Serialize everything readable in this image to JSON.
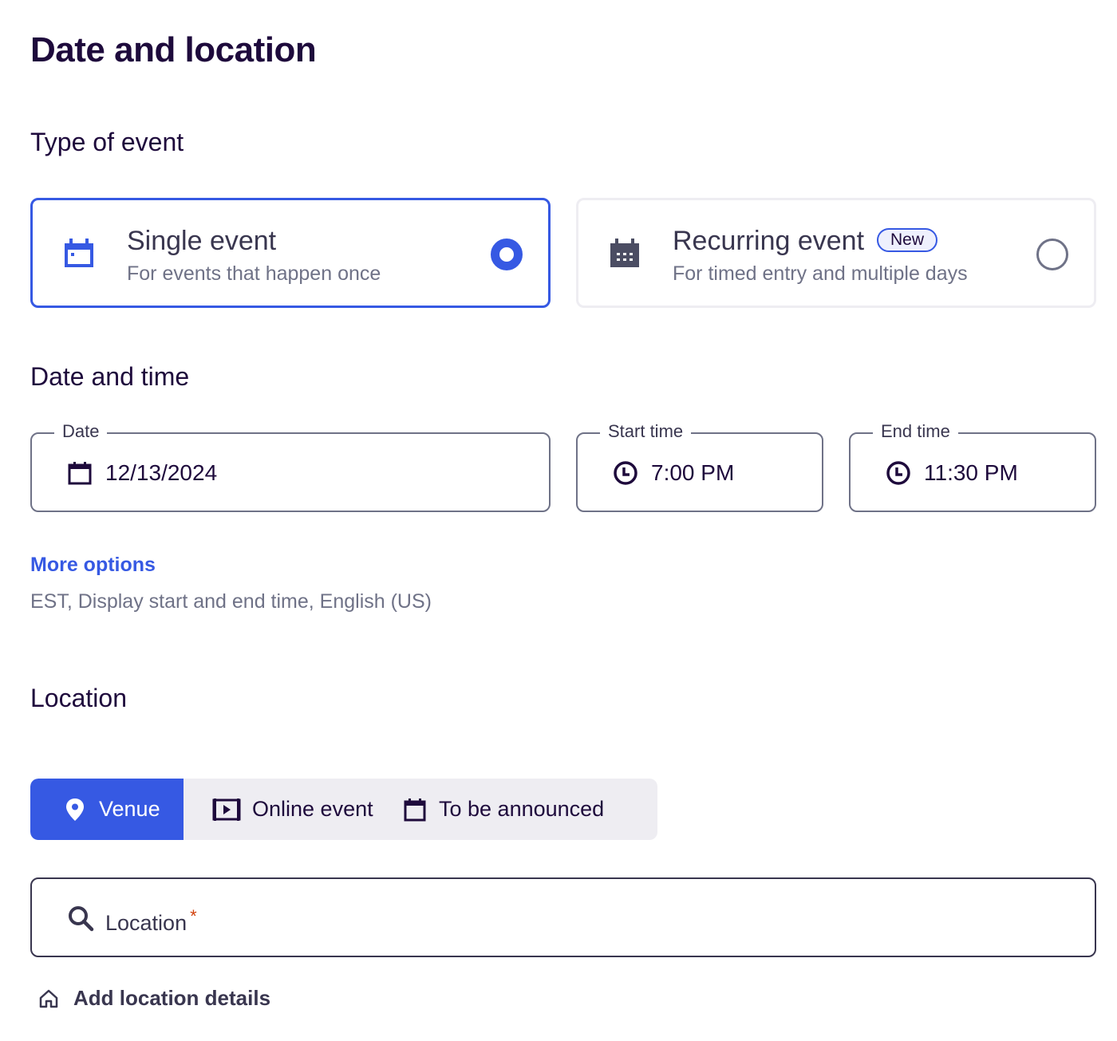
{
  "page": {
    "title": "Date and location"
  },
  "type_of_event": {
    "heading": "Type of event",
    "options": [
      {
        "title": "Single event",
        "subtitle": "For events that happen once",
        "selected": true,
        "icon": "calendar-icon"
      },
      {
        "title": "Recurring event",
        "badge": "New",
        "subtitle": "For timed entry and multiple days",
        "selected": false,
        "icon": "calendar-grid-icon"
      }
    ]
  },
  "date_and_time": {
    "heading": "Date and time",
    "date": {
      "label": "Date",
      "value": "12/13/2024",
      "icon": "calendar-icon"
    },
    "start_time": {
      "label": "Start time",
      "value": "7:00 PM",
      "icon": "clock-icon"
    },
    "end_time": {
      "label": "End time",
      "value": "11:30 PM",
      "icon": "clock-icon"
    },
    "more_options": {
      "link": "More options",
      "summary": "EST, Display start and end time, English (US)"
    }
  },
  "location": {
    "heading": "Location",
    "tabs": [
      {
        "label": "Venue",
        "icon": "map-pin-icon",
        "active": true
      },
      {
        "label": "Online event",
        "icon": "video-icon",
        "active": false
      },
      {
        "label": "To be announced",
        "icon": "calendar-icon",
        "active": false
      }
    ],
    "search": {
      "placeholder": "Location",
      "required_mark": "*",
      "icon": "search-icon"
    },
    "add_details": {
      "label": "Add location details",
      "icon": "home-icon"
    }
  },
  "colors": {
    "accent": "#3659e3",
    "text": "#1e0a3c",
    "muted": "#6f7287",
    "segment_bg": "#eeedf2",
    "required": "#d1410c"
  }
}
